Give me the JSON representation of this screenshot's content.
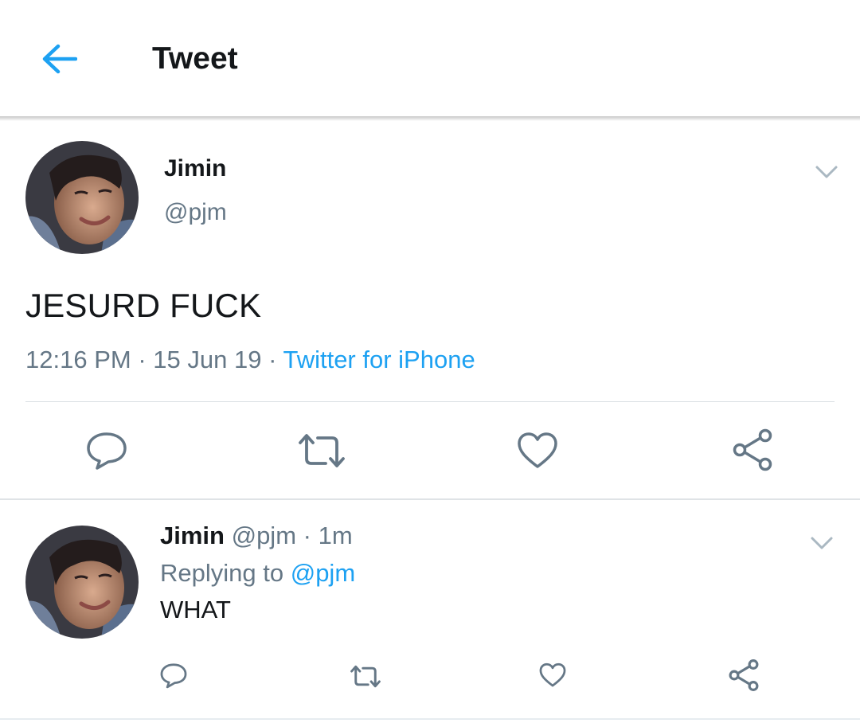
{
  "header": {
    "title": "Tweet",
    "back_icon": "arrow-left-icon"
  },
  "main_tweet": {
    "author_name": "Jimin",
    "author_handle": "@pjm",
    "text": "JESURD FUCK",
    "time": "12:16 PM",
    "date": "15 Jun 19",
    "separator": "·",
    "source": "Twitter for iPhone",
    "actions": [
      "reply-icon",
      "retweet-icon",
      "like-icon",
      "share-icon"
    ]
  },
  "reply_tweet": {
    "author_name": "Jimin",
    "author_handle": "@pjm",
    "separator": "·",
    "time_ago": "1m",
    "replying_to_label": "Replying to",
    "replying_to_handle": "@pjm",
    "text": "WHAT",
    "actions": [
      "reply-icon",
      "retweet-icon",
      "like-icon",
      "share-icon"
    ]
  },
  "colors": {
    "accent": "#1da1f2",
    "text_primary": "#14171a",
    "text_secondary": "#657786",
    "icon_gray": "#657786",
    "chevron_gray": "#aab8c2",
    "divider": "#e6ecf0"
  }
}
